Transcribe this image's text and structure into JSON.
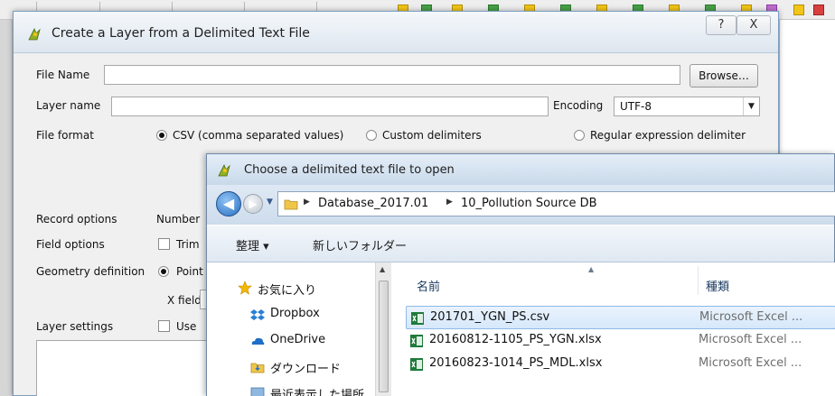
{
  "main_dialog": {
    "title": "Create a Layer from a Delimited Text File",
    "help_button": "?",
    "close_button": "X",
    "file_name_label": "File Name",
    "file_name_value": "",
    "browse_button": "Browse…",
    "layer_name_label": "Layer name",
    "layer_name_value": "",
    "encoding_label": "Encoding",
    "encoding_value": "UTF-8",
    "file_format_label": "File format",
    "format_options": {
      "csv": "CSV (comma separated values)",
      "custom": "Custom delimiters",
      "regex": "Regular expression delimiter"
    },
    "selected_format": "csv",
    "record_options_label": "Record options",
    "record_options_text": "Number",
    "field_options_label": "Field options",
    "field_options_text": "Trim",
    "geometry_label": "Geometry definition",
    "geometry_option_text": "Point",
    "x_field_label": "X field",
    "layer_settings_label": "Layer settings",
    "layer_settings_text": "Use"
  },
  "file_dialog": {
    "title": "Choose a delimited text file to open",
    "breadcrumb": [
      "Database_2017.01",
      "10_Pollution Source DB"
    ],
    "toolbar": {
      "organize": "整理 ▾",
      "new_folder": "新しいフォルダー"
    },
    "nav_items": [
      {
        "label": "お気に入り",
        "icon": "star-icon"
      },
      {
        "label": "Dropbox",
        "icon": "dropbox-icon"
      },
      {
        "label": "OneDrive",
        "icon": "onedrive-icon"
      },
      {
        "label": "ダウンロード",
        "icon": "download-folder-icon"
      },
      {
        "label": "最近表示した場所",
        "icon": "recent-places-icon"
      }
    ],
    "columns": {
      "name": "名前",
      "type": "種類"
    },
    "files": [
      {
        "name": "201701_YGN_PS.csv",
        "type": "Microsoft Excel ...",
        "selected": true
      },
      {
        "name": "20160812-1105_PS_YGN.xlsx",
        "type": "Microsoft Excel ...",
        "selected": false
      },
      {
        "name": "20160823-1014_PS_MDL.xlsx",
        "type": "Microsoft Excel ...",
        "selected": false
      }
    ]
  },
  "colors": {
    "selection_bg": "#d6e8fb",
    "selection_border": "#8ebae8",
    "dialog_bg": "#f0f0f0",
    "explorer_chrome": "#c7d7e8"
  }
}
